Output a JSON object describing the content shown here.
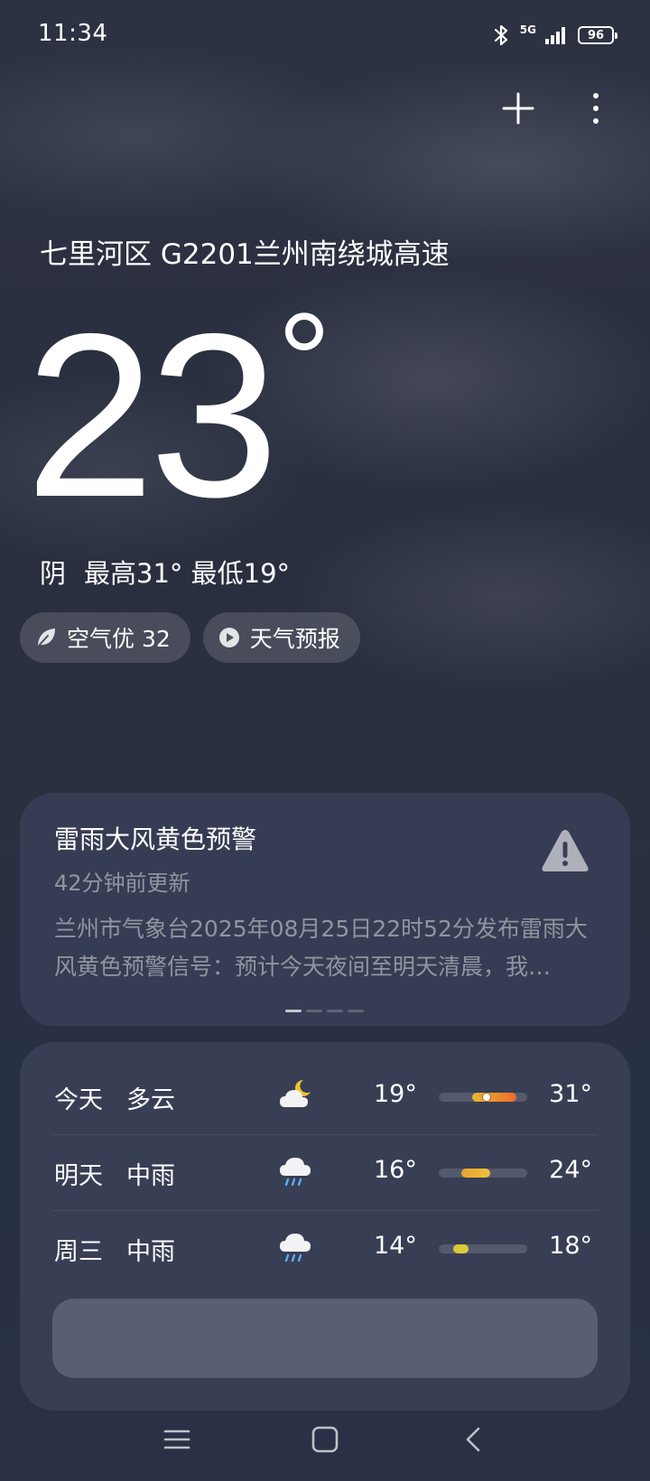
{
  "status_bar": {
    "time": "11:34",
    "network": "5G",
    "battery": "96",
    "icons": [
      "bluetooth-icon",
      "signal-icon",
      "battery-icon"
    ]
  },
  "top_actions": {
    "icons": [
      "plus-icon",
      "more-vertical-icon"
    ]
  },
  "location": "七里河区 G2201兰州南绕城高速",
  "current": {
    "temperature": "23",
    "degree_symbol": "°",
    "condition": "阴",
    "high": "最高31°",
    "low": "最低19°"
  },
  "chips": {
    "air_quality": "空气优 32",
    "forecast_video": "天气预报",
    "icons": [
      "leaf-icon",
      "play-icon"
    ]
  },
  "warning": {
    "title": "雷雨大风黄色预警",
    "updated": "42分钟前更新",
    "description": "兰州市气象台2025年08月25日22时52分发布雷雨大风黄色预警信号：预计今天夜间至明天清晨，我…",
    "icon": "warning-triangle-icon",
    "pages": 4,
    "active_page": 1
  },
  "forecast": [
    {
      "day": "今天",
      "condition": "多云",
      "icon": "cloudy-night-icon",
      "low": "19°",
      "high": "31°",
      "low_value": 19,
      "high_value": 31,
      "current_value": 23,
      "colors": [
        "#e8b82f",
        "#f06a2a"
      ]
    },
    {
      "day": "明天",
      "condition": "中雨",
      "icon": "rain-icon",
      "low": "16°",
      "high": "24°",
      "low_value": 16,
      "high_value": 24,
      "colors": [
        "#e8a32f",
        "#eec23a"
      ]
    },
    {
      "day": "周三",
      "condition": "中雨",
      "icon": "rain-icon",
      "low": "14°",
      "high": "18°",
      "low_value": 14,
      "high_value": 18,
      "colors": [
        "#d6c83a",
        "#e0cc3a"
      ]
    }
  ],
  "forecast_range": {
    "min": 10,
    "max": 34
  },
  "nav_bar": {
    "icons": [
      "menu-icon",
      "home-icon",
      "back-icon"
    ]
  },
  "colors": {
    "background": "#2b3042",
    "card": "#3a4058"
  }
}
